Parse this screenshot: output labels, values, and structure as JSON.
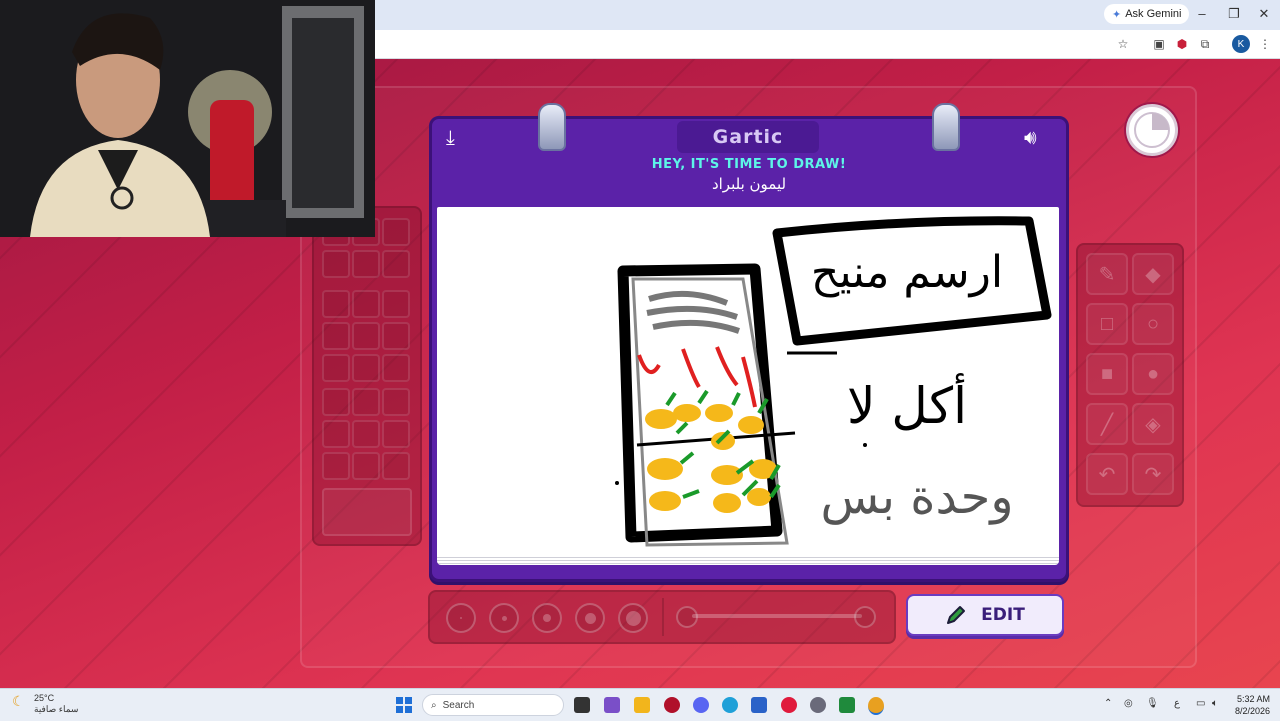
{
  "browser": {
    "gemini_label": "Ask Gemini",
    "window_controls": [
      "minimize-icon",
      "restore-icon",
      "close-icon"
    ],
    "profile_initial": "K",
    "extensions": [
      "bookmark-star-icon",
      "extension-icon",
      "abp-icon",
      "puzzle-icon"
    ]
  },
  "game": {
    "logo": "Gartic",
    "headline": "HEY, IT'S TIME TO DRAW!",
    "word": "ليمون بلبراد",
    "edit_label": "EDIT",
    "accent_color": "#5b22a8",
    "headline_color": "#5df5e8"
  },
  "drawing": {
    "box_text": "ارسم منيح",
    "line_two": "أكل لا",
    "line_three": "وحدة بس"
  },
  "tools": [
    "pencil-icon",
    "eraser-icon",
    "rect-outline-icon",
    "circle-outline-icon",
    "rect-fill-icon",
    "circle-fill-icon",
    "line-icon",
    "fill-bucket-icon",
    "undo-icon",
    "redo-icon"
  ],
  "taskbar": {
    "temperature": "25°C",
    "weather_text": "سماء صافية",
    "search_placeholder": "Search",
    "time": "5:32 AM",
    "date": "8/2/2026",
    "lang": "ع"
  }
}
